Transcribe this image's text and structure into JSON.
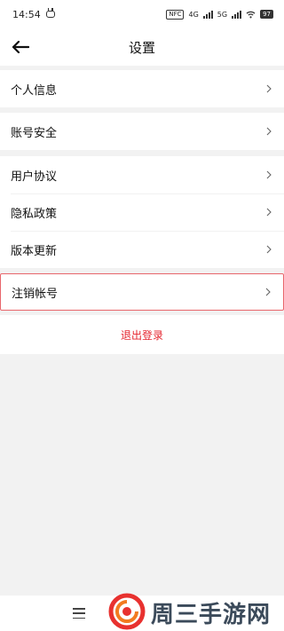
{
  "status_bar": {
    "time": "14:54",
    "nfc": "NFC",
    "net1": "4G",
    "net2": "5G",
    "battery": "97"
  },
  "header": {
    "title": "设置"
  },
  "settings": {
    "personal_info": "个人信息",
    "account_security": "账号安全",
    "user_agreement": "用户协议",
    "privacy_policy": "隐私政策",
    "version_update": "版本更新",
    "cancel_account": "注销帐号"
  },
  "logout_label": "退出登录",
  "watermark": {
    "text": "周三手游网"
  },
  "icons": {
    "back": "arrow-left-icon",
    "chevron": "chevron-right-icon",
    "menu": "menu-icon"
  }
}
